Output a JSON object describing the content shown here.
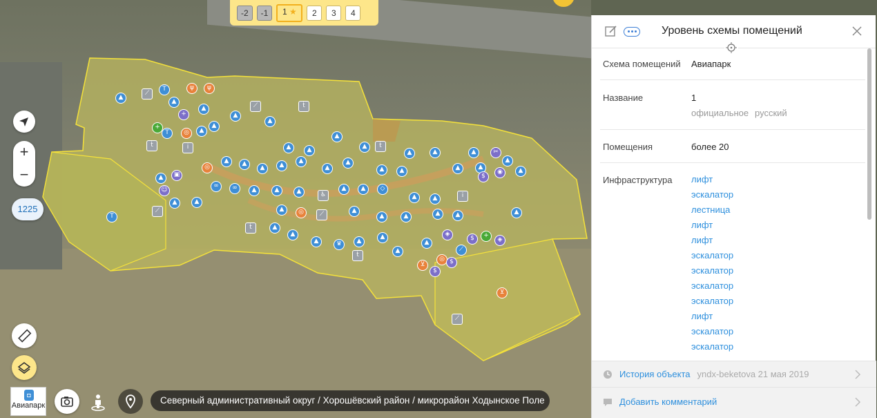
{
  "floors": {
    "items": [
      {
        "label": "-2",
        "kind": "under"
      },
      {
        "label": "-1",
        "kind": "under"
      },
      {
        "label": "1",
        "kind": "active"
      },
      {
        "label": "2",
        "kind": "normal"
      },
      {
        "label": "3",
        "kind": "normal"
      },
      {
        "label": "4",
        "kind": "normal"
      }
    ],
    "active_star": "★"
  },
  "map": {
    "zoom_in": "+",
    "zoom_out": "−",
    "zoom_level": "1225",
    "org_badge": "Авиапарк",
    "breadcrumb": "Северный административный округ / Хорошёвский район / микрорайон Ходынское Поле",
    "colors": {
      "mall": "#c9c069",
      "outline": "#f5e23a",
      "poi_blue": "#3f8fd6",
      "poi_orange": "#e8823b",
      "poi_purple": "#7c6fc9",
      "poi_green": "#49a937"
    }
  },
  "panel": {
    "title": "Уровень схемы помещений",
    "rows": {
      "scheme": {
        "label": "Схема помещений",
        "value": "Авиапарк"
      },
      "name": {
        "label": "Название",
        "value": "1",
        "sub1": "официальное",
        "sub2": "русский"
      },
      "rooms": {
        "label": "Помещения",
        "value": "более 20"
      },
      "infra": {
        "label": "Инфраструктура",
        "items": [
          "лифт",
          "эскалатор",
          "лестница",
          "лифт",
          "лифт",
          "эскалатор",
          "эскалатор",
          "эскалатор",
          "эскалатор",
          "лифт",
          "эскалатор",
          "эскалатор"
        ]
      }
    },
    "history": {
      "label": "История объекта",
      "meta": "yndx-beketova 21 мая 2019"
    },
    "comment": {
      "label": "Добавить комментарий"
    }
  }
}
